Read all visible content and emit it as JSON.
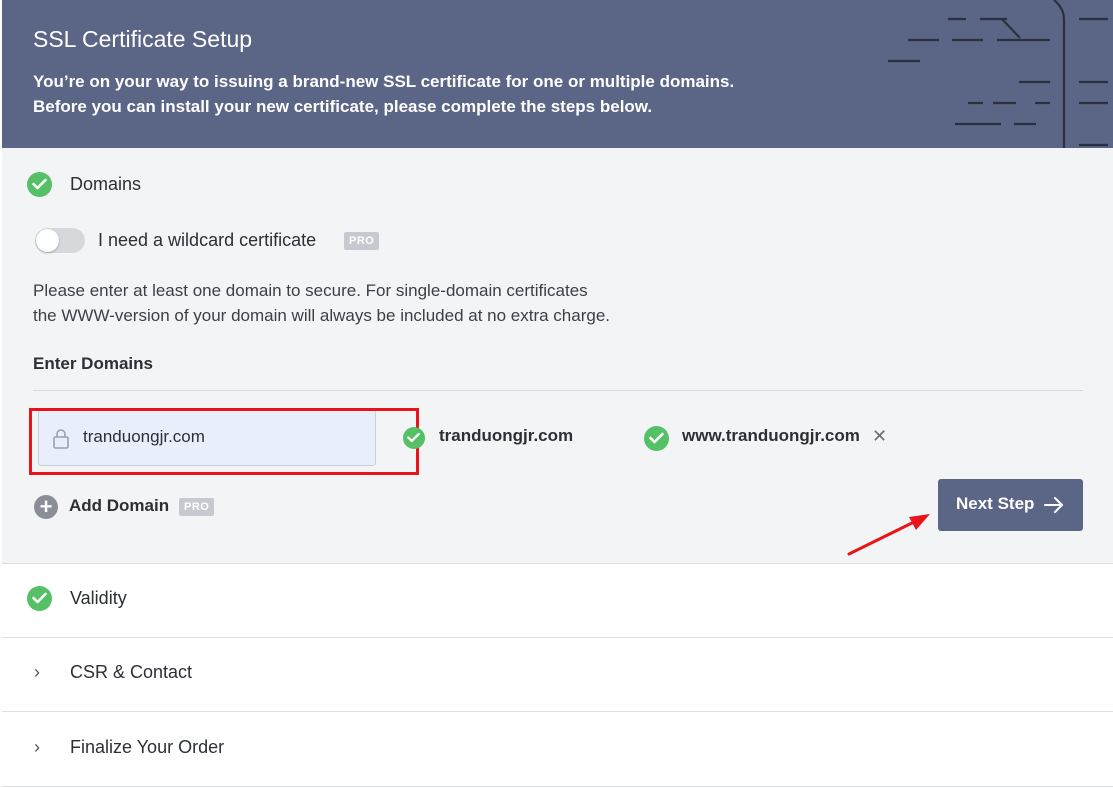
{
  "header": {
    "title": "SSL Certificate Setup",
    "line1": "You’re on your way to issuing a brand-new SSL certificate for one or multiple domains.",
    "line2": "Before you can install your new certificate, please complete the steps below."
  },
  "domains_section": {
    "title": "Domains",
    "wildcard_label": "I need a wildcard certificate",
    "wildcard_enabled": false,
    "pro_badge": "PRO",
    "help_line1": "Please enter at least one domain to secure. For single-domain certificates",
    "help_line2": "the WWW-version of your domain will always be included at no extra charge.",
    "enter_label": "Enter Domains",
    "input_value": "tranduongjr.com",
    "domain_1": "tranduongjr.com",
    "domain_2": "www.tranduongjr.com",
    "remove_symbol": "✕",
    "add_symbol": "+",
    "add_label": "Add Domain",
    "add_pro_badge": "PRO",
    "next_label": "Next Step"
  },
  "sections": {
    "validity": "Validity",
    "csr": "CSR & Contact",
    "finalize": "Finalize Your Order",
    "chevron": "›"
  },
  "colors": {
    "header_bg": "#5b6585",
    "success": "#55c066",
    "annotation": "#e8141a"
  },
  "icons": [
    "check-icon",
    "lock-icon",
    "close-icon",
    "plus-icon",
    "arrow-right-icon",
    "chevron-right-icon"
  ]
}
